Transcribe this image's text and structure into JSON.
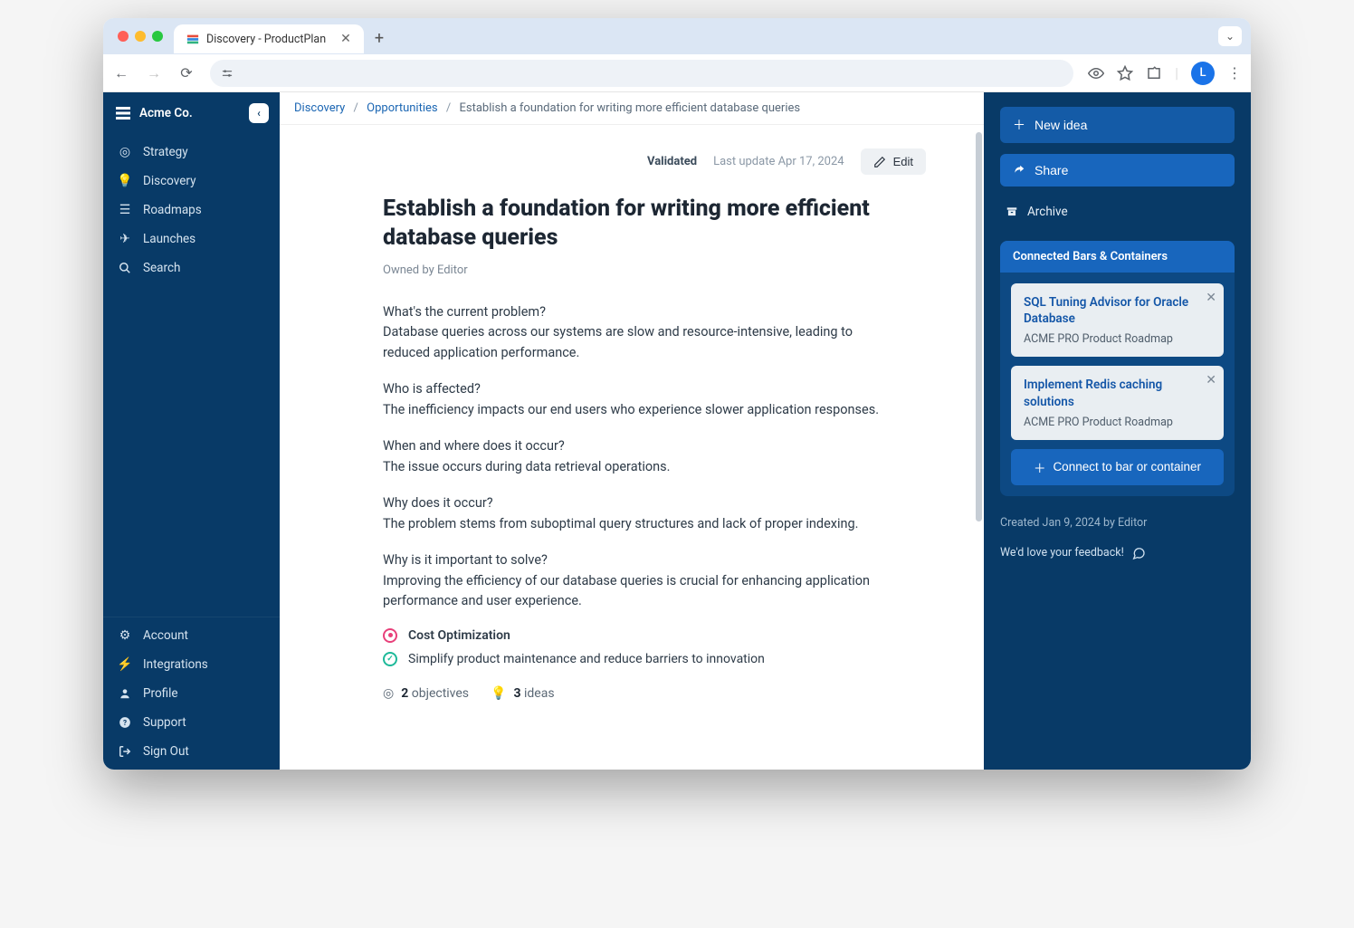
{
  "browser": {
    "tab_title": "Discovery - ProductPlan",
    "avatar_letter": "L"
  },
  "sidebar": {
    "company": "Acme Co.",
    "nav": [
      {
        "label": "Strategy",
        "icon": "target-icon"
      },
      {
        "label": "Discovery",
        "icon": "bulb-icon"
      },
      {
        "label": "Roadmaps",
        "icon": "list-icon"
      },
      {
        "label": "Launches",
        "icon": "rocket-icon"
      },
      {
        "label": "Search",
        "icon": "search-icon"
      }
    ],
    "bottom": [
      {
        "label": "Account",
        "icon": "gear-icon"
      },
      {
        "label": "Integrations",
        "icon": "plug-icon"
      },
      {
        "label": "Profile",
        "icon": "user-icon"
      },
      {
        "label": "Support",
        "icon": "help-icon"
      },
      {
        "label": "Sign Out",
        "icon": "signout-icon"
      }
    ]
  },
  "breadcrumbs": {
    "a": "Discovery",
    "b": "Opportunities",
    "c": "Establish a foundation for writing more efficient database queries"
  },
  "header": {
    "status": "Validated",
    "updated": "Last update Apr 17, 2024",
    "edit_label": "Edit"
  },
  "page": {
    "title": "Establish a foundation for writing more efficient database queries",
    "owner": "Owned by Editor",
    "qa": [
      {
        "q": "What's the current problem?",
        "a": "Database queries across our systems are slow and resource-intensive, leading to reduced application performance."
      },
      {
        "q": "Who is affected?",
        "a": "The inefficiency impacts our end users who experience slower application responses."
      },
      {
        "q": "When and where does it occur?",
        "a": "The issue occurs during data retrieval operations."
      },
      {
        "q": "Why does it occur?",
        "a": "The problem stems from suboptimal query structures and lack of proper indexing."
      },
      {
        "q": "Why is it important to solve?",
        "a": "Improving the efficiency of our database queries is crucial for enhancing application performance and user experience."
      }
    ],
    "tags": [
      {
        "label": "Cost Optimization",
        "color": "pink"
      },
      {
        "label": "Simplify product maintenance and reduce barriers to innovation",
        "color": "teal"
      }
    ],
    "counts": {
      "objectives_n": "2",
      "objectives_label": "objectives",
      "ideas_n": "3",
      "ideas_label": "ideas"
    }
  },
  "right": {
    "new_idea": "New idea",
    "share": "Share",
    "archive": "Archive",
    "section_title": "Connected Bars & Containers",
    "cards": [
      {
        "title": "SQL Tuning Advisor for Oracle Database",
        "sub": "ACME PRO Product Roadmap"
      },
      {
        "title": "Implement Redis caching solutions",
        "sub": "ACME PRO Product Roadmap"
      }
    ],
    "connect": "Connect to bar or container",
    "created": "Created Jan 9, 2024 by Editor",
    "feedback": "We'd love your feedback!"
  }
}
